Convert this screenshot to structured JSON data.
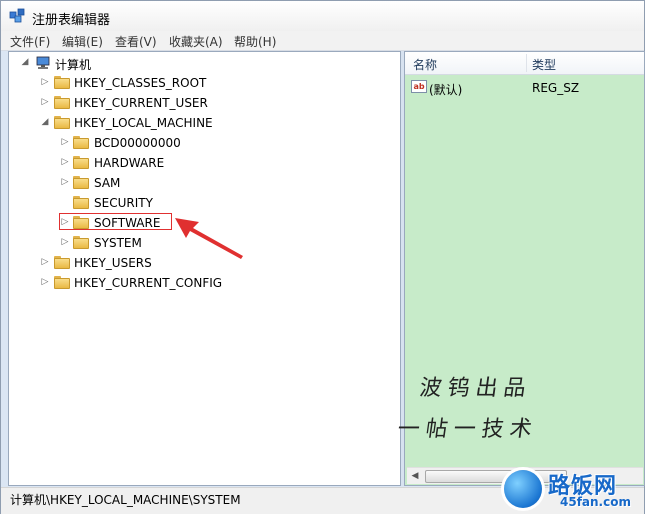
{
  "window": {
    "title": "注册表编辑器"
  },
  "menu": [
    "文件(F)",
    "编辑(E)",
    "查看(V)",
    "收藏夹(A)",
    "帮助(H)"
  ],
  "tree": {
    "root": "计算机",
    "hives": [
      {
        "label": "HKEY_CLASSES_ROOT",
        "expander": "▷"
      },
      {
        "label": "HKEY_CURRENT_USER",
        "expander": "▷"
      },
      {
        "label": "HKEY_LOCAL_MACHINE",
        "expander": "◢"
      },
      {
        "label": "HKEY_USERS",
        "expander": "▷"
      },
      {
        "label": "HKEY_CURRENT_CONFIG",
        "expander": "▷"
      }
    ],
    "hklm_children": [
      {
        "label": "BCD00000000",
        "expander": "▷"
      },
      {
        "label": "HARDWARE",
        "expander": "▷"
      },
      {
        "label": "SAM",
        "expander": "▷"
      },
      {
        "label": "SECURITY",
        "expander": ""
      },
      {
        "label": "SOFTWARE",
        "expander": "▷"
      },
      {
        "label": "SYSTEM",
        "expander": "▷"
      }
    ],
    "selected": "SYSTEM",
    "highlighted": "SOFTWARE"
  },
  "list": {
    "columns": [
      "名称",
      "类型"
    ],
    "rows": [
      {
        "name": "(默认)",
        "type": "REG_SZ",
        "icon": "string-value-icon"
      }
    ]
  },
  "status": {
    "path": "计算机\\HKEY_LOCAL_MACHINE\\SYSTEM"
  },
  "watermark": {
    "line1": "波钨出品",
    "line2": "一帖一技术"
  },
  "logo": {
    "name": "路饭网",
    "url_text": "45fan.com"
  },
  "colors": {
    "list_bg": "#c7ebc9",
    "highlight": "#e03030",
    "logo_blue": "#1769c9"
  }
}
